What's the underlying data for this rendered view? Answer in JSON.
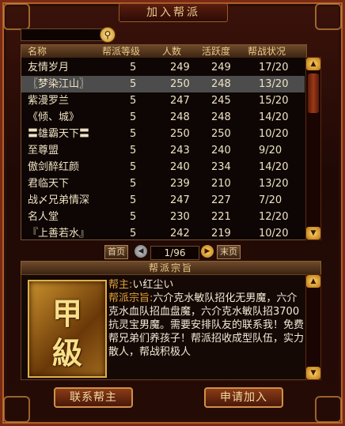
{
  "window": {
    "title": "加入帮派"
  },
  "search": {
    "value": "",
    "button_icon": "search-icon"
  },
  "table": {
    "headers": [
      "名称",
      "帮派等级",
      "人数",
      "活跃度",
      "帮战状况"
    ],
    "rows": [
      {
        "name": "友情岁月",
        "level": "5",
        "members": "249",
        "activity": "249",
        "war": "17/20"
      },
      {
        "name": "〖梦染江山〗",
        "level": "5",
        "members": "250",
        "activity": "248",
        "war": "13/20"
      },
      {
        "name": "紫漫罗兰",
        "level": "5",
        "members": "247",
        "activity": "245",
        "war": "15/20"
      },
      {
        "name": "《倾、城》",
        "level": "5",
        "members": "248",
        "activity": "248",
        "war": "14/20"
      },
      {
        "name": "〓雄霸天下〓",
        "level": "5",
        "members": "250",
        "activity": "250",
        "war": "10/20"
      },
      {
        "name": "至尊盟",
        "level": "5",
        "members": "243",
        "activity": "240",
        "war": "9/20"
      },
      {
        "name": "傲剑醉红颜",
        "level": "5",
        "members": "240",
        "activity": "234",
        "war": "14/20"
      },
      {
        "name": "君临天下",
        "level": "5",
        "members": "239",
        "activity": "210",
        "war": "13/20"
      },
      {
        "name": "战〆兄弟情深",
        "level": "5",
        "members": "247",
        "activity": "227",
        "war": "7/20"
      },
      {
        "name": "名人堂",
        "level": "5",
        "members": "230",
        "activity": "221",
        "war": "12/20"
      },
      {
        "name": "『上善若水』",
        "level": "5",
        "members": "242",
        "activity": "219",
        "war": "10/20"
      }
    ],
    "selected_index": 1
  },
  "pager": {
    "first": "首页",
    "page": "1/96",
    "last": "末页"
  },
  "details": {
    "section_title": "帮派宗旨",
    "badge_top": "甲",
    "badge_bottom": "級",
    "leader_label": "帮主:",
    "leader": "い红尘い",
    "motto_label": "帮派宗旨:",
    "motto": "六介克水敏队招化无男魔，六介克水血队招血盘魔，六介克水敏队招3700抗灵宝男魔。需要安排队友的联系我！免费帮兄弟们养孩子！帮派招收成型队伍，实力散人，帮战积极人"
  },
  "buttons": {
    "contact": "联系帮主",
    "apply": "申请加入"
  },
  "colors": {
    "accent": "#e0a03a",
    "text": "#efe2c4",
    "selected_row": "#4c4c4c",
    "frame": "#7a2a14"
  }
}
